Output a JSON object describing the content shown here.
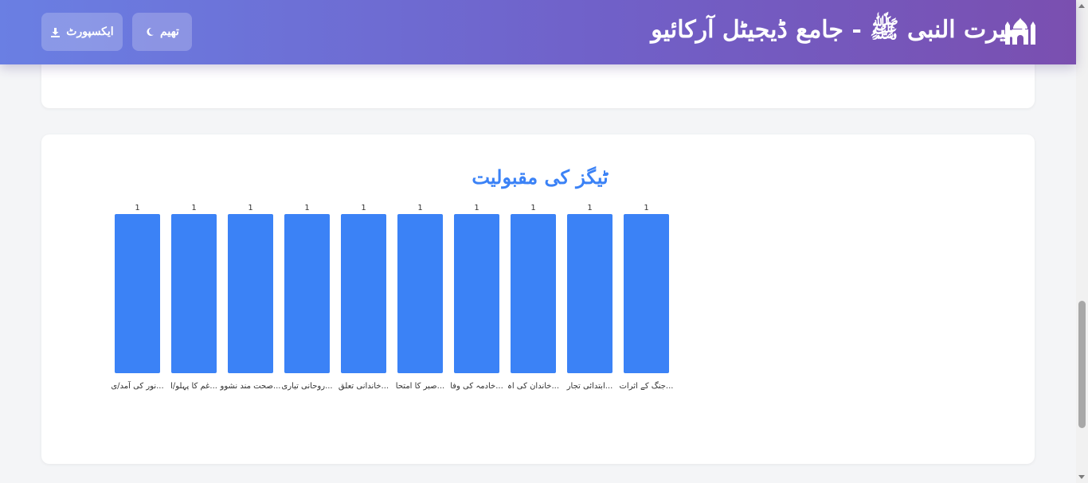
{
  "header": {
    "title": "سیرت النبی ﷺ - جامع ڈیجیٹل آرکائیو",
    "theme_button": "تھیم",
    "export_button": "ایکسپورٹ",
    "icons": {
      "logo": "mosque-icon",
      "theme": "moon-icon",
      "export": "download-icon"
    }
  },
  "chart_data": {
    "type": "bar",
    "title": "ٹیگز کی مقبولیت",
    "color": "#3b82f6",
    "title_color": "#3b82f6",
    "categories": [
      "جنگ کے اثرات...",
      "ابتدائی تجار...",
      "خاندان کی اہ...",
      "خادمہ کی وفا...",
      "صبر کا امتحا...",
      "خاندانی تعلق...",
      "روحانی تیاری...",
      "صحت مند نشوو...",
      "غم کا پہلو/ا...",
      "نور کی آمد/ی..."
    ],
    "values": [
      1,
      1,
      1,
      1,
      1,
      1,
      1,
      1,
      1,
      1
    ],
    "ylim": [
      0,
      1
    ],
    "grid": false
  }
}
